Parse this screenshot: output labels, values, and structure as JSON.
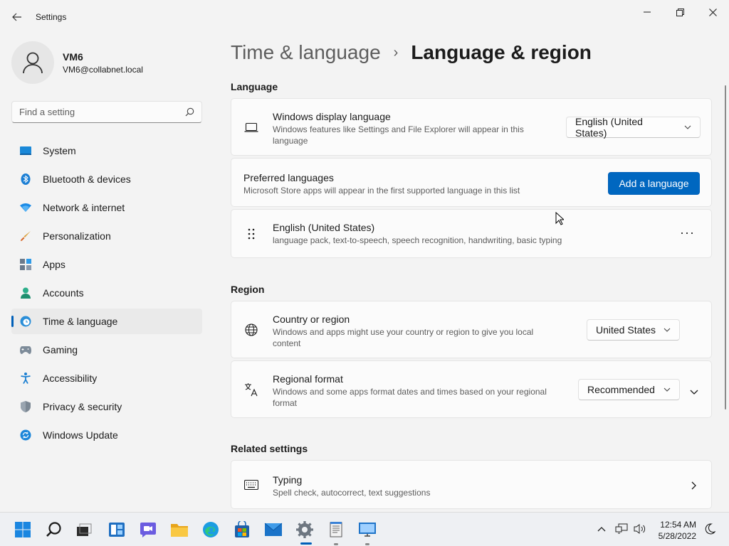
{
  "window": {
    "title": "Settings"
  },
  "profile": {
    "name": "VM6",
    "email": "VM6@collabnet.local"
  },
  "search": {
    "placeholder": "Find a setting"
  },
  "sidebar": {
    "items": [
      {
        "label": "System",
        "icon": "system-icon"
      },
      {
        "label": "Bluetooth & devices",
        "icon": "bluetooth-icon"
      },
      {
        "label": "Network & internet",
        "icon": "network-icon"
      },
      {
        "label": "Personalization",
        "icon": "brush-icon"
      },
      {
        "label": "Apps",
        "icon": "apps-icon"
      },
      {
        "label": "Accounts",
        "icon": "accounts-icon"
      },
      {
        "label": "Time & language",
        "icon": "time-language-icon",
        "active": true
      },
      {
        "label": "Gaming",
        "icon": "gamepad-icon"
      },
      {
        "label": "Accessibility",
        "icon": "accessibility-icon"
      },
      {
        "label": "Privacy & security",
        "icon": "shield-icon"
      },
      {
        "label": "Windows Update",
        "icon": "update-icon"
      }
    ]
  },
  "breadcrumb": {
    "parent": "Time & language",
    "separator": "›",
    "current": "Language & region"
  },
  "sections": {
    "language": {
      "title": "Language",
      "display_language": {
        "title": "Windows display language",
        "description": "Windows features like Settings and File Explorer will appear in this language",
        "value": "English (United States)"
      },
      "preferred": {
        "title": "Preferred languages",
        "description": "Microsoft Store apps will appear in the first supported language in this list",
        "button": "Add a language"
      },
      "language_item": {
        "title": "English (United States)",
        "description": "language pack, text-to-speech, speech recognition, handwriting, basic typing",
        "more": "···"
      }
    },
    "region": {
      "title": "Region",
      "country": {
        "title": "Country or region",
        "description": "Windows and apps might use your country or region to give you local content",
        "value": "United States"
      },
      "format": {
        "title": "Regional format",
        "description": "Windows and some apps format dates and times based on your regional format",
        "value": "Recommended"
      }
    },
    "related": {
      "title": "Related settings",
      "typing": {
        "title": "Typing",
        "description": "Spell check, autocorrect, text suggestions"
      }
    }
  },
  "taskbar": {
    "apps": [
      "start-icon",
      "search-icon",
      "task-view-icon",
      "widgets-icon",
      "chat-icon",
      "file-explorer-icon",
      "edge-icon",
      "store-icon",
      "mail-icon",
      "settings-icon",
      "notepad-icon",
      "remote-desktop-icon"
    ],
    "time": "12:54 AM",
    "date": "5/28/2022"
  },
  "colors": {
    "accent": "#0067c0",
    "background": "#f3f3f3",
    "card": "#fbfbfb"
  }
}
